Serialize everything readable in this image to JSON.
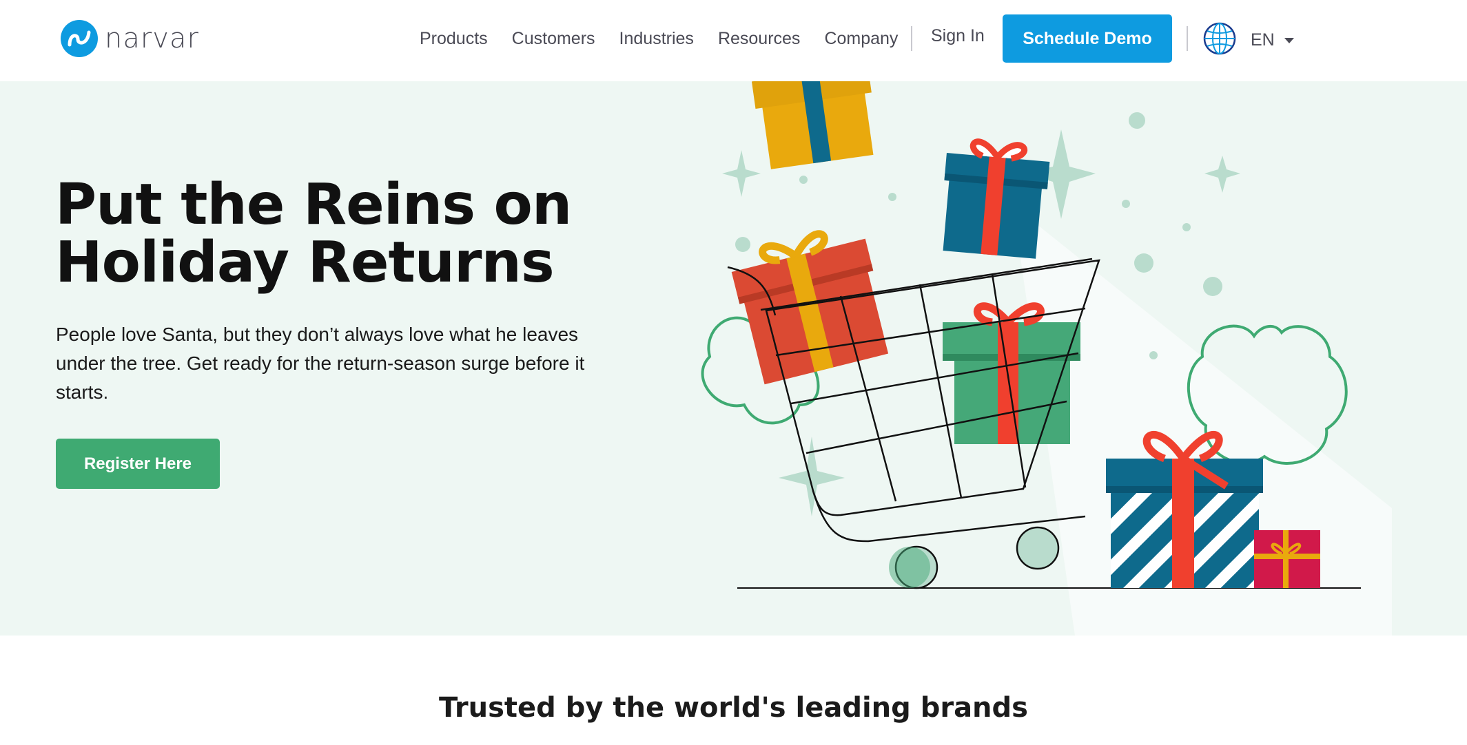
{
  "brand": {
    "name": "narvar",
    "logo_color": "#0e9be0"
  },
  "nav": {
    "items": [
      {
        "label": "Products"
      },
      {
        "label": "Customers"
      },
      {
        "label": "Industries"
      },
      {
        "label": "Resources"
      },
      {
        "label": "Company"
      }
    ],
    "sign_in": "Sign In",
    "cta": "Schedule Demo",
    "cta_color": "#0e9be0",
    "language": "EN",
    "language_icon": "globe-icon"
  },
  "hero": {
    "title_line1": "Put the Reins on",
    "title_line2": "Holiday Returns",
    "body": "People love Santa, but they don’t always love what he leaves under the tree. Get ready for the return-season surge before it starts.",
    "cta": "Register Here",
    "cta_color": "#3faa72",
    "background": "#eef7f3"
  },
  "trusted": {
    "heading": "Trusted by the world's leading brands"
  }
}
